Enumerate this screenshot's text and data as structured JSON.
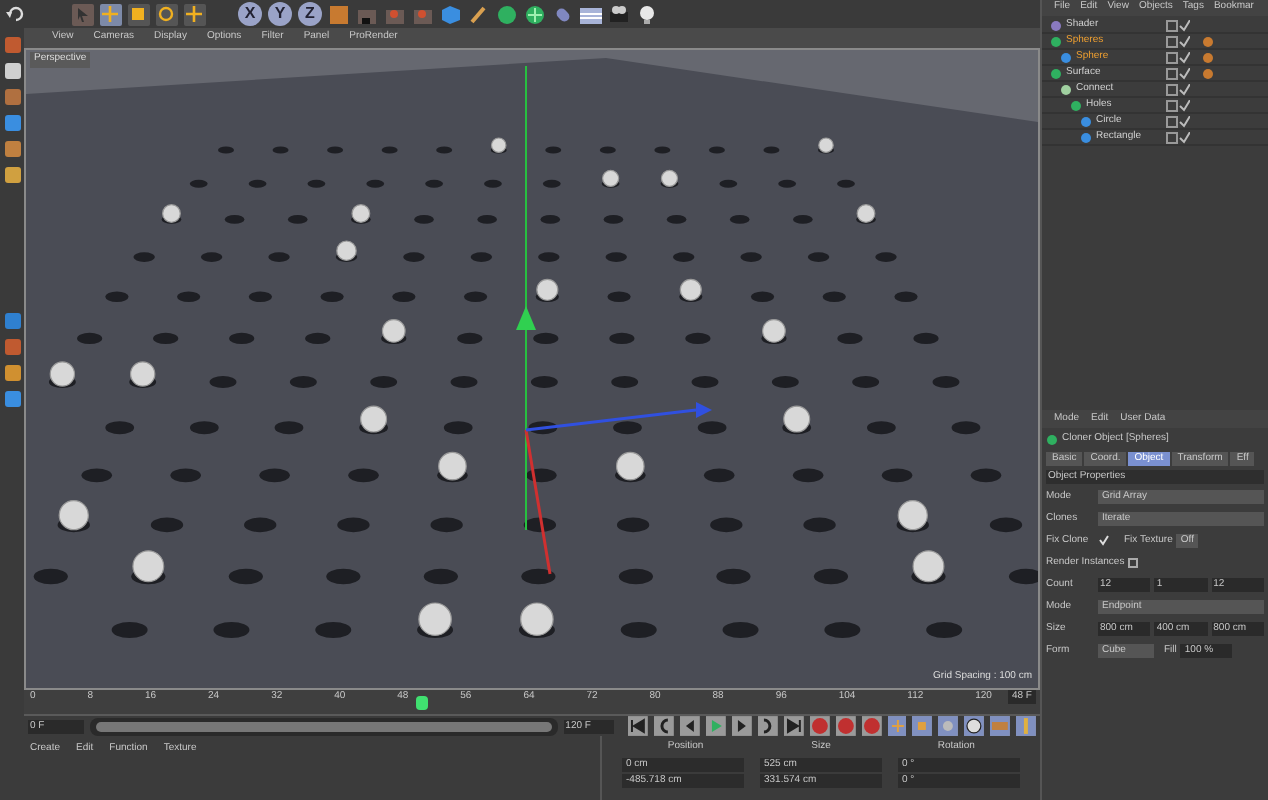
{
  "toolbar": {
    "axis_locks": [
      {
        "label": "X",
        "on": true
      },
      {
        "label": "Y",
        "on": true
      },
      {
        "label": "Z",
        "on": true
      }
    ]
  },
  "viewport": {
    "menu": [
      "View",
      "Cameras",
      "Display",
      "Options",
      "Filter",
      "Panel",
      "ProRender"
    ],
    "camera": "Perspective",
    "grid_spacing": "Grid Spacing : 100 cm"
  },
  "timeline": {
    "ticks": [
      "0",
      "8",
      "16",
      "24",
      "32",
      "40",
      "48",
      "56",
      "64",
      "72",
      "80",
      "88",
      "96",
      "104",
      "112",
      "120"
    ],
    "current_frame": "48 F",
    "level": 0.4,
    "range": {
      "level": 1
    },
    "start": "0 F",
    "end": "120 F"
  },
  "material_menu": [
    "Create",
    "Edit",
    "Function",
    "Texture"
  ],
  "coordinates": {
    "headers": [
      "Position",
      "Size",
      "Rotation"
    ],
    "rows": [
      [
        "0 cm",
        "525 cm",
        "0 °"
      ],
      [
        "-485.718 cm",
        "331.574 cm",
        "0 °"
      ]
    ]
  },
  "object_manager": {
    "menu": [
      "File",
      "Edit",
      "View",
      "Objects",
      "Tags",
      "Bookmar"
    ],
    "tree": [
      {
        "name": "Shader",
        "kind": "shader",
        "selected": false
      },
      {
        "name": "Spheres",
        "kind": "cloner",
        "selected": true,
        "children": [
          {
            "name": "Sphere",
            "kind": "sphere",
            "selected": true
          }
        ]
      },
      {
        "name": "Surface",
        "kind": "generator",
        "selected": false,
        "children": [
          {
            "name": "Connect",
            "kind": "connect",
            "selected": false,
            "children": [
              {
                "name": "Holes",
                "kind": "generator",
                "selected": false,
                "children": [
                  {
                    "name": "Circle",
                    "kind": "spline",
                    "selected": false
                  },
                  {
                    "name": "Rectangle",
                    "kind": "spline",
                    "selected": false
                  }
                ]
              }
            ]
          }
        ]
      }
    ]
  },
  "attributes": {
    "menu": [
      "Mode",
      "Edit",
      "User Data"
    ],
    "title": "Cloner Object [Spheres]",
    "tabs": [
      {
        "label": "Basic",
        "selected": false
      },
      {
        "label": "Coord.",
        "selected": false
      },
      {
        "label": "Object",
        "selected": true
      },
      {
        "label": "Transform",
        "selected": false
      },
      {
        "label": "Eff",
        "selected": false
      }
    ],
    "section": "Object Properties",
    "fields": [
      {
        "kind": "dropdown",
        "label": "Mode",
        "value": "Grid Array"
      },
      {
        "kind": "dropdown",
        "label": "Clones",
        "value": "Iterate"
      },
      {
        "kind": "pair",
        "label": "Fix Clone",
        "checked": true,
        "label2": "Fix Texture",
        "value2": "Off"
      },
      {
        "kind": "checkbox",
        "label": "Render Instances",
        "checked": false
      },
      {
        "kind": "triple",
        "label": "Count",
        "values": [
          "12",
          "1",
          "12"
        ]
      },
      {
        "kind": "dropdown",
        "label": "Mode",
        "value": "Endpoint"
      },
      {
        "kind": "triple",
        "label": "Size",
        "values": [
          "800 cm",
          "400 cm",
          "800 cm"
        ]
      },
      {
        "kind": "form",
        "label": "Form",
        "value": "Cube",
        "label2": "Fill",
        "value2": "100 %"
      }
    ]
  }
}
